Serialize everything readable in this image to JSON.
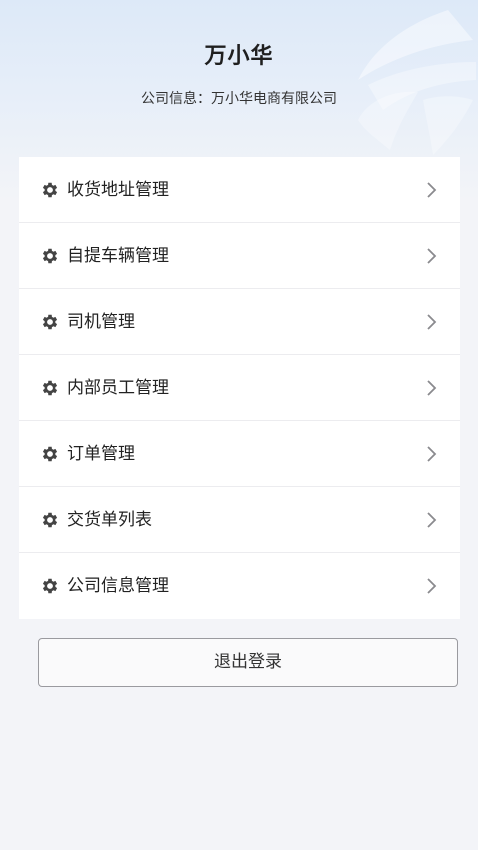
{
  "header": {
    "user_name": "万小华",
    "company_label": "公司信息：",
    "company_name": "万小华电商有限公司"
  },
  "menu": {
    "items": [
      {
        "label": "收货地址管理",
        "icon": "gear-icon"
      },
      {
        "label": "自提车辆管理",
        "icon": "gear-icon"
      },
      {
        "label": "司机管理",
        "icon": "gear-icon"
      },
      {
        "label": "内部员工管理",
        "icon": "gear-icon"
      },
      {
        "label": "订单管理",
        "icon": "gear-icon"
      },
      {
        "label": "交货单列表",
        "icon": "gear-icon"
      },
      {
        "label": "公司信息管理",
        "icon": "gear-icon"
      }
    ]
  },
  "logout": {
    "label": "退出登录"
  },
  "colors": {
    "header_gradient_top": "#dde9f8",
    "page_background": "#f3f4f8",
    "card_background": "#ffffff",
    "icon_color": "#444444",
    "chevron_color": "#8a8a8e"
  }
}
